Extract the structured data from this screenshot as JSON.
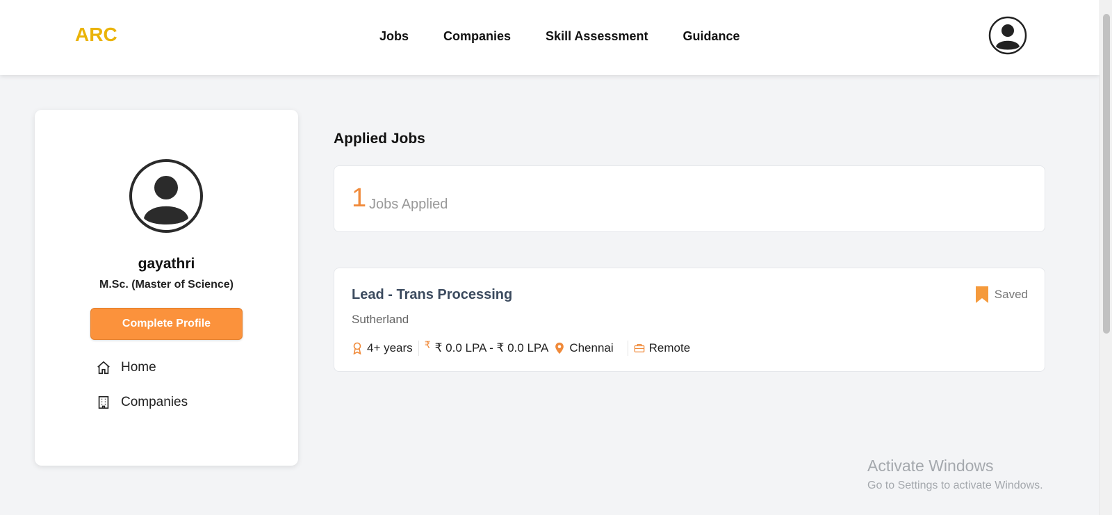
{
  "header": {
    "logo_text": "ARC",
    "nav": [
      "Jobs",
      "Companies",
      "Skill Assessment",
      "Guidance"
    ],
    "brand_color": "#eab308"
  },
  "profile": {
    "name": "gayathri",
    "degree": "M.Sc. (Master of Science)",
    "complete_button": "Complete Profile",
    "links": [
      "Home",
      "Companies"
    ]
  },
  "applied": {
    "title": "Applied Jobs",
    "count": "1",
    "count_label": "Jobs Applied"
  },
  "job": {
    "title": "Lead - Trans Processing",
    "company": "Sutherland",
    "saved_label": "Saved",
    "experience": "4+ years",
    "salary": "₹ 0.0 LPA - ₹ 0.0 LPA",
    "location": "Chennai",
    "work_mode": "Remote",
    "currency_symbol": "₹"
  },
  "watermark": {
    "line1": "Activate Windows",
    "line2": "Go to Settings to activate Windows."
  }
}
